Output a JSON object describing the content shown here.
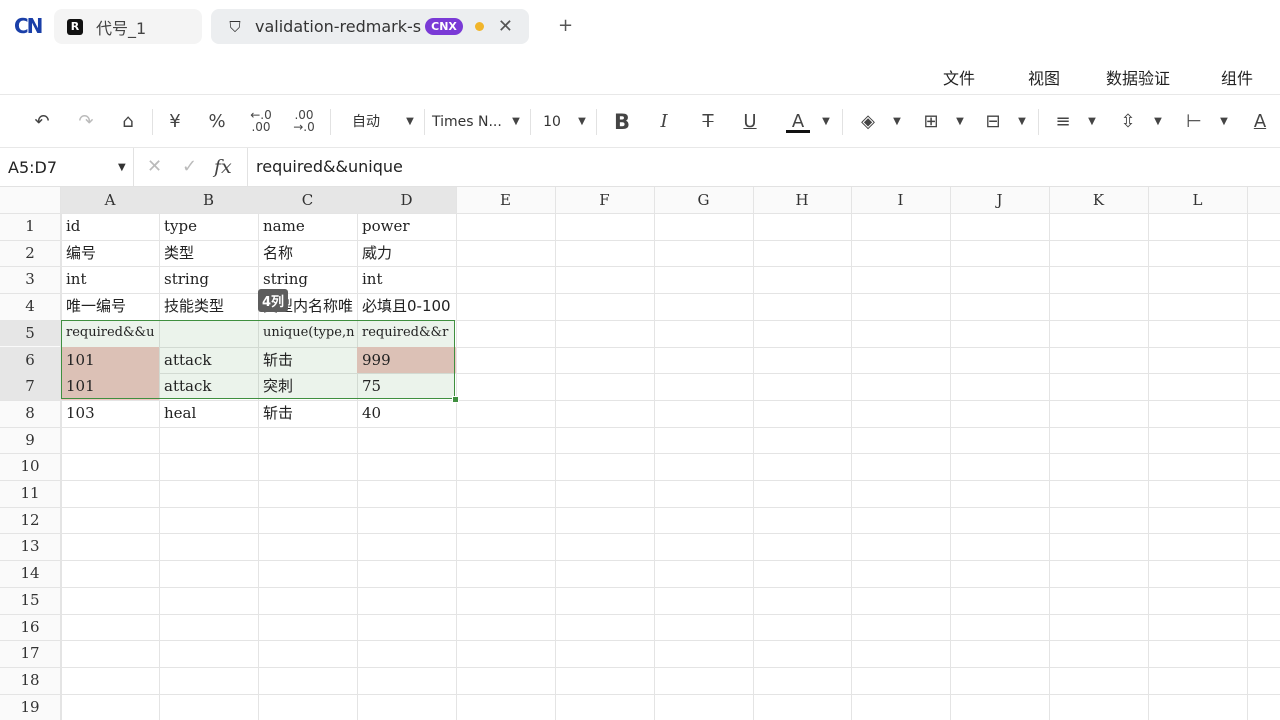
{
  "tabs": [
    {
      "label": "代号_1",
      "icon": "app-logo-icon"
    },
    {
      "label": "validation-redmark-s",
      "badge": "CNX",
      "icon": "shield-icon"
    }
  ],
  "menu": [
    "文件",
    "视图",
    "数据验证",
    "组件"
  ],
  "toolbar": {
    "number_format": "自动",
    "font_name": "Times N...",
    "font_size": "10",
    "currency": "¥",
    "percent": "%",
    "dec_dec": ".0\n.00",
    "inc_dec": ".00\n.0"
  },
  "formula_bar": {
    "name_box": "A5:D7",
    "formula": "required&&unique"
  },
  "columns": [
    "A",
    "B",
    "C",
    "D",
    "E",
    "F",
    "G",
    "H",
    "I",
    "J",
    "K",
    "L"
  ],
  "rows": [
    "1",
    "2",
    "3",
    "4",
    "5",
    "6",
    "7",
    "8",
    "9",
    "10",
    "11",
    "12",
    "13",
    "14",
    "15",
    "16",
    "17",
    "18",
    "19"
  ],
  "cells": {
    "r1": [
      "id",
      "type",
      "name",
      "power"
    ],
    "r2": [
      "编号",
      "类型",
      "名称",
      "威力"
    ],
    "r3": [
      "int",
      "string",
      "string",
      "int"
    ],
    "r4": [
      "唯一编号",
      "技能类型",
      "类型内名称唯",
      "必填且0-100"
    ],
    "r5": [
      "required&&u",
      "",
      "unique(type,n",
      "required&&r"
    ],
    "r6": [
      "101",
      "attack",
      "斩击",
      "999"
    ],
    "r7": [
      "101",
      "attack",
      "突刺",
      "75"
    ],
    "r8": [
      "103",
      "heal",
      "斩击",
      "40"
    ]
  },
  "tooltip": "4列",
  "colors": {
    "selection_border": "#3f8f3f",
    "error_fill": "#efc8c4",
    "badge": "#7a3ad6"
  }
}
